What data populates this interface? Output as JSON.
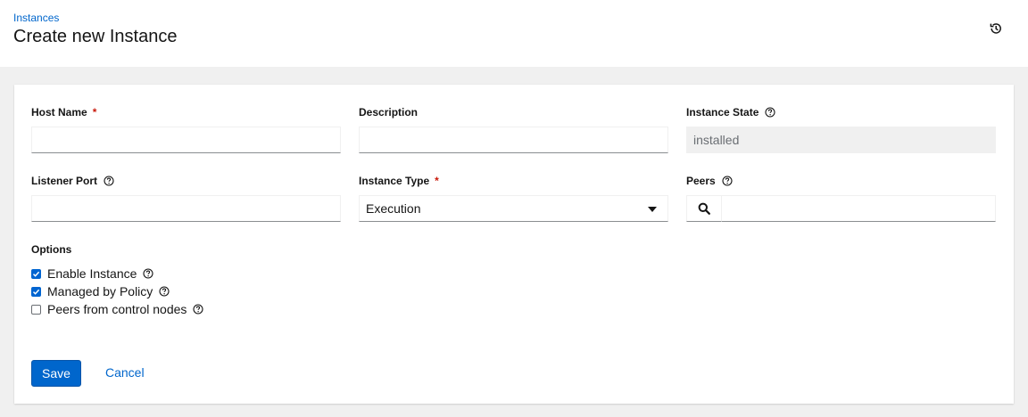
{
  "breadcrumb": "Instances",
  "page_title": "Create new Instance",
  "icons": {
    "history": "history-icon",
    "help": "question-circle-icon",
    "search": "search-icon",
    "caret": "caret-down-icon",
    "check": "check-icon"
  },
  "colors": {
    "primary": "#0066cc",
    "required": "#c9190b",
    "checkbox": "#0065d1"
  },
  "form": {
    "host_name": {
      "label": "Host Name",
      "required_mark": "*",
      "value": ""
    },
    "description": {
      "label": "Description",
      "value": ""
    },
    "instance_state": {
      "label": "Instance State",
      "value": "installed"
    },
    "listener_port": {
      "label": "Listener Port",
      "value": ""
    },
    "instance_type": {
      "label": "Instance Type",
      "required_mark": "*",
      "value": "Execution"
    },
    "peers": {
      "label": "Peers",
      "value": ""
    },
    "options": {
      "label": "Options",
      "items": [
        {
          "label": "Enable Instance",
          "checked": true
        },
        {
          "label": "Managed by Policy",
          "checked": true
        },
        {
          "label": "Peers from control nodes",
          "checked": false
        }
      ]
    }
  },
  "actions": {
    "save": "Save",
    "cancel": "Cancel"
  }
}
